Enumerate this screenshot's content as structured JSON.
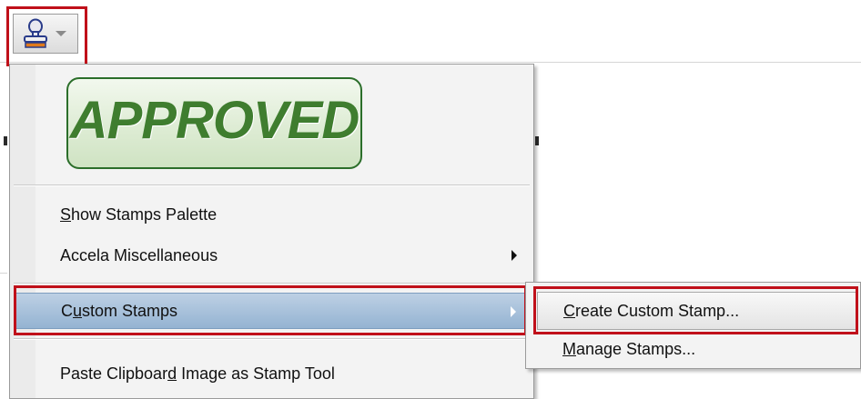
{
  "toolbar": {
    "stamp_tool": {
      "icon": "stamp-icon",
      "dropdown_icon": "chevron-down-icon"
    }
  },
  "stamp_menu": {
    "preview_stamp": {
      "text": "APPROVED",
      "color": "#3f7d2f"
    },
    "items": [
      {
        "pre": "",
        "key": "S",
        "post": "how Stamps Palette",
        "has_submenu": false
      },
      {
        "pre": "Accela Miscellaneous",
        "key": "",
        "post": "",
        "has_submenu": true
      },
      {
        "pre": "C",
        "key": "u",
        "post": "stom Stamps",
        "has_submenu": true,
        "active": true
      },
      {
        "pre": "Paste Clipboar",
        "key": "d",
        "post": " Image as Stamp Tool",
        "has_submenu": false
      }
    ]
  },
  "custom_stamps_submenu": {
    "items": [
      {
        "pre": "",
        "key": "C",
        "post": "reate Custom Stamp...",
        "active": true
      },
      {
        "pre": "",
        "key": "M",
        "post": "anage Stamps...",
        "active": false
      }
    ]
  },
  "highlight_color": "#c0101a"
}
